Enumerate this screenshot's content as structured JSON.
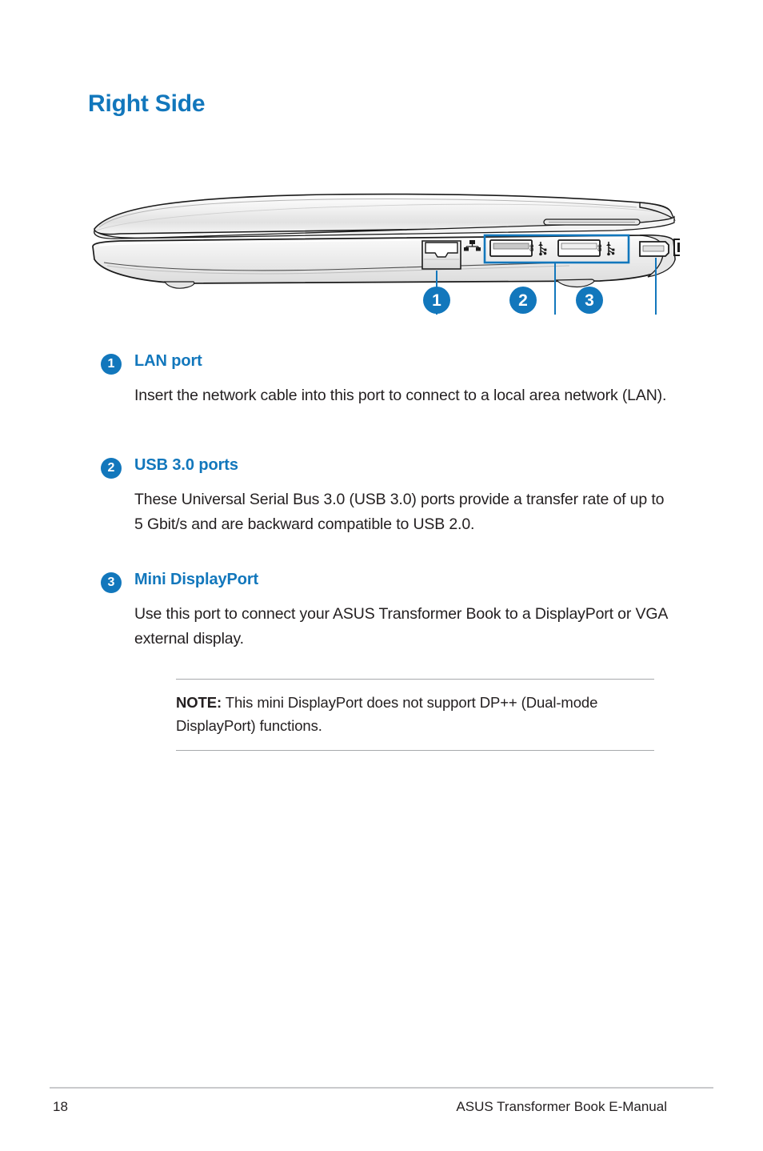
{
  "document": {
    "page_title": "Right Side",
    "accent_color": "#1277bc",
    "text_color": "#231f20"
  },
  "illustration": {
    "name": "laptop-right-side-view",
    "callouts": [
      {
        "number": "1",
        "target": "lan-port"
      },
      {
        "number": "2",
        "target": "usb-3-ports"
      },
      {
        "number": "3",
        "target": "mini-displayport"
      }
    ],
    "port_icons": {
      "lan": "lan-port-icon",
      "usb1": "usb-superspeed-icon",
      "usb2": "usb-superspeed-icon",
      "displayport": "displayport-icon"
    }
  },
  "sections": [
    {
      "number": "1",
      "title": "LAN port",
      "body": "Insert the network cable into this port to connect to a local area network (LAN)."
    },
    {
      "number": "2",
      "title": "USB 3.0 ports",
      "body": "These Universal Serial Bus 3.0 (USB 3.0) ports provide a transfer rate of up to 5 Gbit/s and are backward compatible to USB 2.0."
    },
    {
      "number": "3",
      "title": "Mini DisplayPort",
      "body": "Use this port to connect your ASUS Transformer Book to a DisplayPort or VGA external display."
    }
  ],
  "note": {
    "label": "NOTE:",
    "text": " This mini DisplayPort does not support DP++ (Dual-mode DisplayPort) functions."
  },
  "footer": {
    "page_number": "18",
    "manual_title": "ASUS Transformer Book E-Manual"
  }
}
